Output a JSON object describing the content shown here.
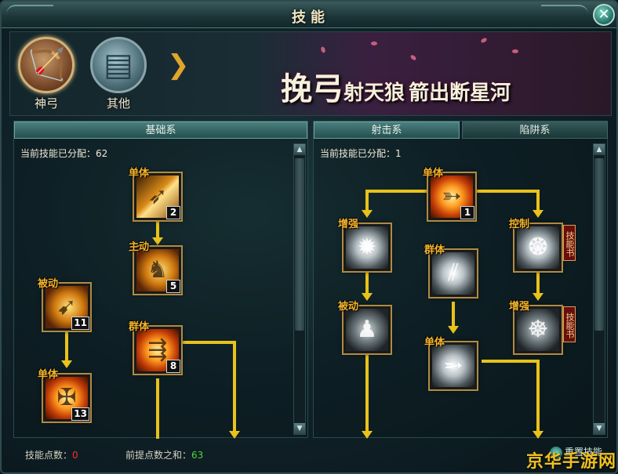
{
  "window": {
    "title": "技能",
    "close_glyph": "✕"
  },
  "header": {
    "class_tabs": [
      {
        "label": "神弓",
        "icon": "bow-icon",
        "active": true
      },
      {
        "label": "其他",
        "icon": "scroll-icon",
        "active": false
      }
    ],
    "next_arrow": "❯",
    "slogan": {
      "part1": "挽弓",
      "part2": "射天狼",
      "part3": "箭出断星河"
    }
  },
  "left_panel": {
    "tab": "基础系",
    "allocated_label": "当前技能已分配：",
    "allocated_value": "62",
    "skills": [
      {
        "type": "单体",
        "level": "2",
        "art": "gold2",
        "icon": "arrow-volley-icon"
      },
      {
        "type": "主动",
        "level": "5",
        "art": "gold",
        "icon": "archer-pose-icon"
      },
      {
        "type": "被动",
        "level": "11",
        "art": "gold",
        "icon": "spear-icon"
      },
      {
        "type": "群体",
        "level": "8",
        "art": "fire",
        "icon": "multi-arrow-icon"
      },
      {
        "type": "单体",
        "level": "13",
        "art": "fire",
        "icon": "crossbow-icon"
      }
    ]
  },
  "right_panel": {
    "tabs": [
      "射击系",
      "陷阱系"
    ],
    "allocated_label": "当前技能已分配：",
    "allocated_value": "1",
    "skills": [
      {
        "type": "单体",
        "level": "1",
        "art": "fire",
        "icon": "fire-arrow-icon"
      },
      {
        "type": "增强",
        "level": "",
        "art": "silver",
        "icon": "light-burst-icon"
      },
      {
        "type": "控制",
        "level": "",
        "art": "silver",
        "icon": "whirl-icon"
      },
      {
        "type": "群体",
        "level": "",
        "art": "silver",
        "icon": "arrow-rain-icon"
      },
      {
        "type": "被动",
        "level": "",
        "art": "dark",
        "icon": "warrior-icon"
      },
      {
        "type": "增强",
        "level": "",
        "art": "dark",
        "icon": "meditate-icon"
      },
      {
        "type": "单体",
        "level": "",
        "art": "silver",
        "icon": "piercing-arrow-icon"
      }
    ],
    "skill_book_label": "技能书"
  },
  "footer": {
    "skill_points_label": "技能点数：",
    "skill_points_value": "0",
    "prereq_label": "前提点数之和：",
    "prereq_value": "63",
    "reset_label": "重置技能"
  },
  "watermark": "京华手游网"
}
